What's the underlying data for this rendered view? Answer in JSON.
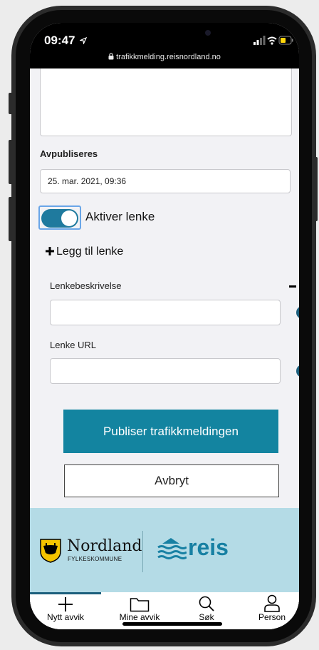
{
  "status_bar": {
    "time": "09:47",
    "url": "trafikkmelding.reisnordland.no"
  },
  "form": {
    "unpublish_label": "Avpubliseres",
    "unpublish_value": "25. mar. 2021, 09:36",
    "toggle_label": "Aktiver lenke",
    "toggle_on": true,
    "add_link_label": "Legg til lenke",
    "link_description_label": "Lenkebeskrivelse",
    "link_url_label": "Lenke URL",
    "help_glyph": "?",
    "publish_button": "Publiser trafikkmeldingen",
    "cancel_button": "Avbryt"
  },
  "footer": {
    "nordland_name": "Nordland",
    "nordland_sub": "FYLKESKOMMUNE",
    "reis_name": "reis"
  },
  "tabbar": [
    {
      "label": "Nytt avvik",
      "icon": "plus-icon"
    },
    {
      "label": "Mine avvik",
      "icon": "folder-icon"
    },
    {
      "label": "Søk",
      "icon": "search-icon"
    },
    {
      "label": "Person",
      "icon": "person-icon"
    }
  ],
  "colors": {
    "accent": "#1384a0",
    "toggle": "#1f7a9e",
    "footer": "#b4dbe6",
    "help": "#1c5f7c"
  }
}
